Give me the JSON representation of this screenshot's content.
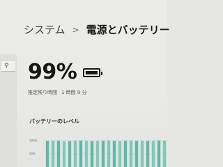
{
  "header": {
    "breadcrumb_parent": "システム",
    "breadcrumb_separator": ">",
    "breadcrumb_current": "電源とバッテリー"
  },
  "search": {
    "icon": "search-icon"
  },
  "battery": {
    "percent_text": "99%",
    "level": 0.99,
    "remaining_label": "推定残り時間",
    "remaining_value": "1 時間 9 分"
  },
  "battery_level_section": {
    "title": "バッテリーのレベル"
  },
  "chart_data": {
    "type": "bar",
    "title": "バッテリーのレベル",
    "ytick_labels": [
      "100%",
      "50%"
    ],
    "ylim": [
      0,
      100
    ],
    "values": [
      98,
      99,
      99,
      97,
      98,
      99,
      100,
      99,
      98,
      99,
      99,
      100,
      99,
      98,
      99,
      100,
      99,
      99,
      98,
      99,
      100,
      99
    ],
    "colors": {
      "bar": "#5fb8a8",
      "bar_alt": "#7fc9bb",
      "grid": "#c7c7c4"
    }
  }
}
